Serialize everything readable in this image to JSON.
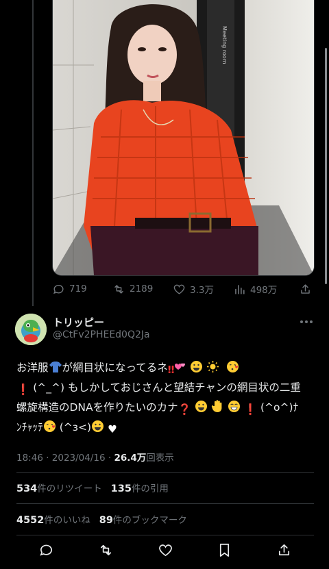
{
  "quoted_tweet": {
    "photo_alt": "Person in orange mesh knit sweater",
    "photo_sign_text": "Meeting room",
    "stats": {
      "replies": "719",
      "retweets": "2189",
      "likes": "3.3万",
      "views": "498万"
    }
  },
  "author": {
    "name": "トリッピー",
    "handle": "@CtFv2PHEEd0Q2Ja"
  },
  "tweet": {
    "line1_a": "お洋服",
    "line1_b": "が網目状になってるネ",
    "line2_a": "(^_^) もしかしておじさんと望結チャンの網目状の二重",
    "line3_a": "螺旋構造のDNAを作りたいのカナ",
    "line3_b": "(^o^)ﾅ",
    "line4_a": "ﾝﾁｬｯﾃ",
    "line4_b": "(^з<)"
  },
  "meta": {
    "time": "18:46",
    "date": "2023/04/16",
    "views_count": "26.4万",
    "views_label": "回表示"
  },
  "counts": {
    "retweets_num": "534",
    "retweets_label": "件のリツイート",
    "quotes_num": "135",
    "quotes_label": "件の引用",
    "likes_num": "4552",
    "likes_label": "件のいいね",
    "bookmarks_num": "89",
    "bookmarks_label": "件のブックマーク"
  },
  "icons": {
    "reply": "reply-icon",
    "retweet": "retweet-icon",
    "like": "heart-icon",
    "bookmark": "bookmark-icon",
    "share": "share-icon",
    "views": "analytics-icon",
    "more": "more-icon"
  },
  "colors": {
    "background": "#000000",
    "text_primary": "#e7e9ea",
    "text_secondary": "#71767b",
    "divider": "#2f3336"
  }
}
